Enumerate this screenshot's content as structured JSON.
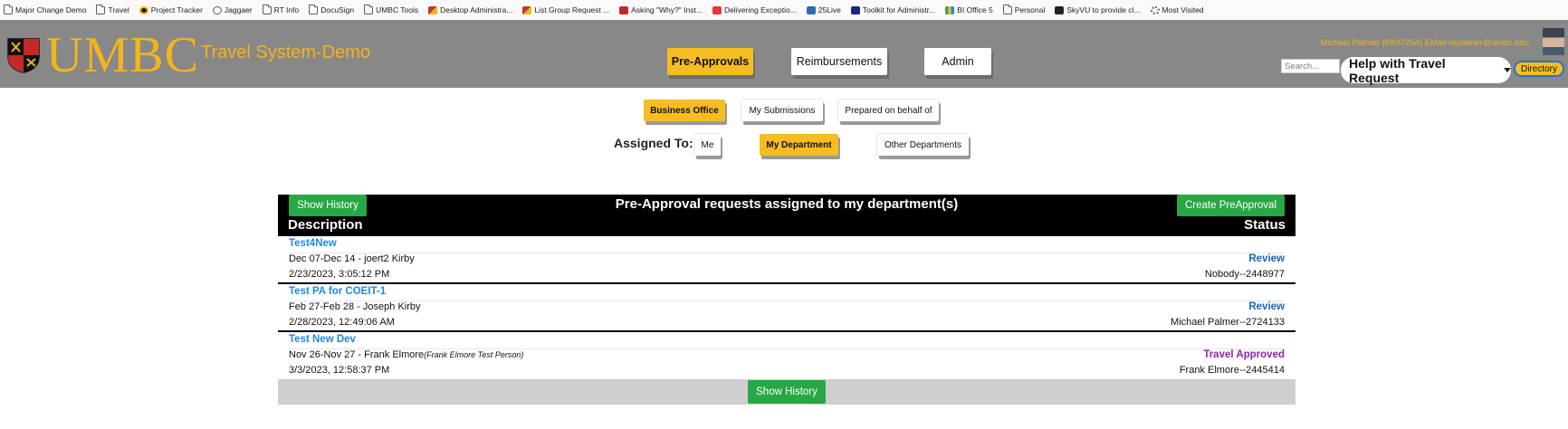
{
  "bookmarks": [
    {
      "label": "Major Change Demo",
      "icon": "folder-icon"
    },
    {
      "label": "Travel",
      "icon": "folder-icon"
    },
    {
      "label": "Project Tracker",
      "icon": "umbc-icon"
    },
    {
      "label": "Jaggaer",
      "icon": "globe-icon"
    },
    {
      "label": "RT Info",
      "icon": "folder-icon"
    },
    {
      "label": "DocuSign",
      "icon": "folder-icon"
    },
    {
      "label": "UMBC Tools",
      "icon": "folder-icon"
    },
    {
      "label": "Desktop Administra...",
      "icon": "shield-icon"
    },
    {
      "label": "List Group Request ...",
      "icon": "shield-icon"
    },
    {
      "label": "Asking \"Why?\" Inst...",
      "icon": "e-icon"
    },
    {
      "label": "Delivering Exceptio...",
      "icon": "youtube-icon"
    },
    {
      "label": "25Live",
      "icon": "25live-icon"
    },
    {
      "label": "Toolkit for Administr...",
      "icon": "x-icon"
    },
    {
      "label": "BI Office 5",
      "icon": "bi-icon"
    },
    {
      "label": "Personal",
      "icon": "folder-icon"
    },
    {
      "label": "SkyVU to provide cl...",
      "icon": "v-icon"
    },
    {
      "label": "Most Visited",
      "icon": "gear-icon"
    }
  ],
  "header": {
    "logo_text": "UMBC",
    "system_title": "Travel System-Demo",
    "nav": [
      "Pre-Approvals",
      "Reimbursements",
      "Admin"
    ],
    "user_info": "Michael Palmer (PA97254) EMail-mpalmer@umbc.edu",
    "search_placeholder": "Search...",
    "help_label": "Help with Travel Request",
    "directory_label": "Directory"
  },
  "filters": {
    "scope": [
      "Business Office",
      "My Submissions",
      "Prepared on behalf of"
    ],
    "assigned_label": "Assigned To:",
    "assigned": [
      "Me",
      "My Department",
      "Other Departments"
    ]
  },
  "table": {
    "show_history_label": "Show History",
    "title": "Pre-Approval requests assigned to my department(s)",
    "create_label": "Create PreApproval",
    "col_description": "Description",
    "col_status": "Status",
    "rows": [
      {
        "title": "Test4New",
        "dates": "Dec 07-Dec 14 - joert2 Kirby",
        "note": "",
        "time": "2/23/2023, 3:05:12 PM",
        "status": "Review",
        "assignee": "Nobody--2448977"
      },
      {
        "title": "Test PA for COEIT-1",
        "dates": "Feb 27-Feb 28 - Joseph Kirby",
        "note": "",
        "time": "2/28/2023, 12:49:06 AM",
        "status": "Review",
        "assignee": "Michael Palmer--2724133"
      },
      {
        "title": "Test New Dev",
        "dates": "Nov 26-Nov 27 - Frank Elmore",
        "note": "(Frank Elmore Test Person)",
        "time": "3/3/2023, 12:58:37 PM",
        "status": "Travel Approved",
        "assignee": "Frank Elmore--2445414"
      }
    ]
  },
  "colors": {
    "header_bg": "#888888",
    "gold": "#f3b51c",
    "active_button": "#f6bd22",
    "green_button": "#28a745",
    "link_blue": "#1e88e5",
    "review_blue": "#1565c0",
    "approved_purple": "#8e24aa"
  }
}
